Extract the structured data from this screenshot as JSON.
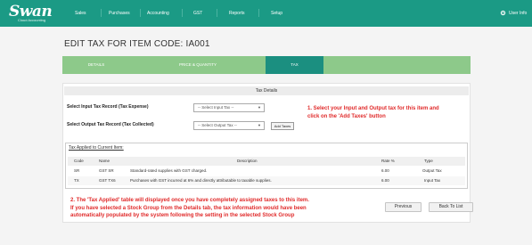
{
  "brand": {
    "name": "Swan",
    "tagline": "Cloud Accounting"
  },
  "nav": {
    "items": [
      "Sales",
      "Purchases",
      "Accounting",
      "GST",
      "Reports",
      "Setup"
    ],
    "user": "User Info"
  },
  "page": {
    "title": "EDIT TAX FOR ITEM CODE: IA001"
  },
  "tabs": [
    {
      "label": "DETAILS",
      "active": false
    },
    {
      "label": "PRICE & QUANTITY",
      "active": false
    },
    {
      "label": "TAX",
      "active": true
    }
  ],
  "tax_details": {
    "heading": "Tax Details",
    "input_label": "Select Input Tax Record (Tax Expense)",
    "input_value": "-- Select Input Tax --",
    "output_label": "Select Output Tax Record (Tax Collected)",
    "output_value": "-- Select Output Tax --",
    "add_button": "Add Taxes"
  },
  "notes": {
    "note1": [
      "1. Select your Input and Output tax for this item and",
      "click on the 'Add Taxes' button"
    ],
    "note2": [
      "2. The 'Tax Applied' table will displayed once you have completely assigned taxes to this item.",
      "If you have selected a Stock Group from the Details tab, the tax information would have been",
      "automatically populated by the system following the setting in the selected Stock Group"
    ]
  },
  "applied": {
    "title": "Tax Applied to Current Item:",
    "columns": [
      "Code",
      "Name",
      "Description",
      "Rate %",
      "Type"
    ],
    "rows": [
      {
        "code": "SR",
        "name": "GST SR",
        "description": "Standard-rated supplies with GST charged.",
        "rate": "6.00",
        "type": "Output Tax"
      },
      {
        "code": "TX",
        "name": "GST TX6",
        "description": "Purchases with GST incurred at 6% and directly attributable to taxable supplies.",
        "rate": "6.00",
        "type": "Input Tax"
      }
    ]
  },
  "buttons": {
    "previous": "Previous",
    "back": "Back To List"
  },
  "colors": {
    "nav": "#1b9a85",
    "tab_strip": "#8dc98a",
    "tab_active": "#1b8f80",
    "note": "#e02a2a"
  }
}
